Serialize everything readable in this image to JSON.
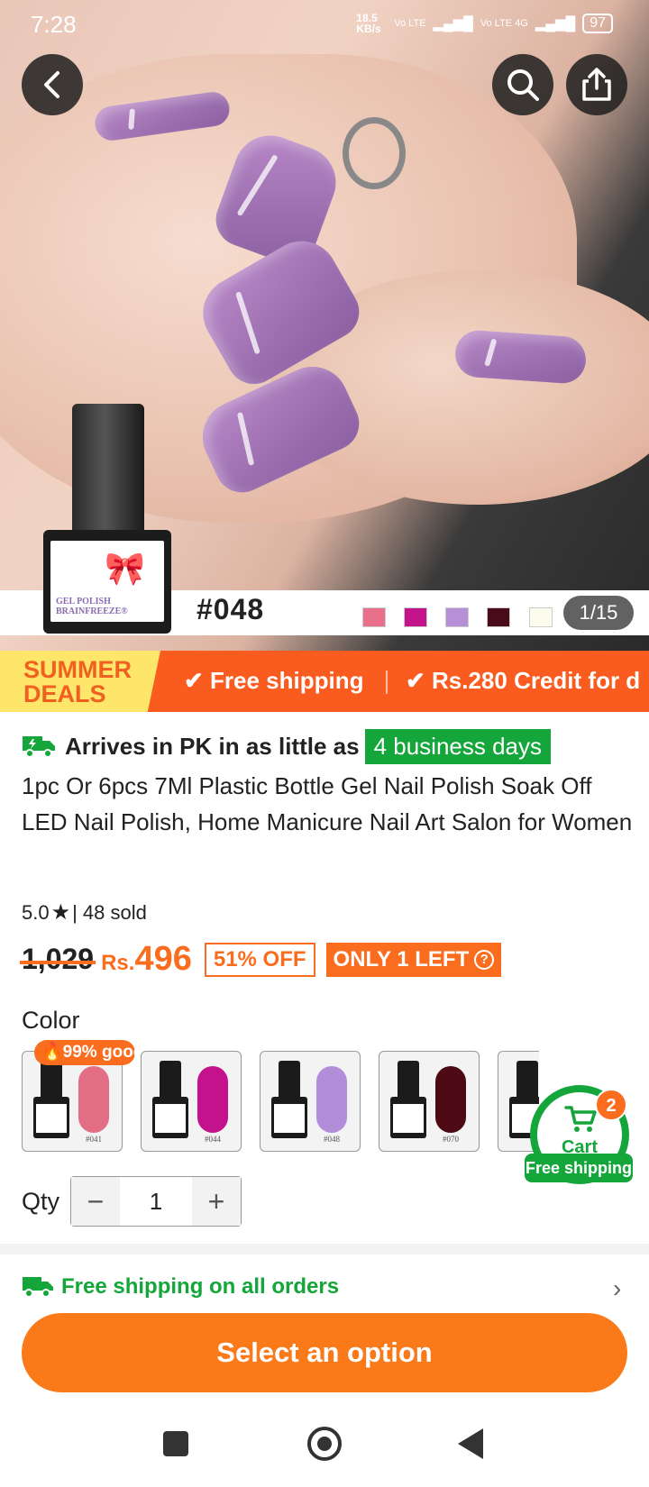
{
  "status_bar": {
    "time": "7:28",
    "net_speed": "18.5 KB/s",
    "sim1": "Vo LTE",
    "sim2": "Vo LTE 4G",
    "battery": "97"
  },
  "hero": {
    "shade_code": "#048",
    "bottle_label": "GEL POLISH BRAINFREEZE®",
    "image_counter": "1/15",
    "swatches": [
      "#e8708a",
      "#c4138a",
      "#b68fd6",
      "#4a0c18",
      "#fbfbee"
    ]
  },
  "promo": {
    "badge_line1": "SUMMER",
    "badge_line2": "DEALS",
    "item1": "✔ Free shipping",
    "item2": "✔ Rs.280 Credit for d"
  },
  "delivery": {
    "text": "Arrives in PK in as little as",
    "badge": "4 business days"
  },
  "product": {
    "title": "1pc Or 6pcs 7Ml Plastic Bottle Gel Nail Polish Soak Off LED Nail Polish, Home Manicure Nail Art Salon for Women",
    "rating": "5.0",
    "sold": "| 48 sold",
    "old_price": "1,029",
    "currency": "Rs.",
    "price": "496",
    "discount": "51% OFF",
    "stock": "ONLY 1 LEFT"
  },
  "color": {
    "label": "Color",
    "good_badge": "99% good",
    "options": [
      {
        "code": "#041",
        "hex": "#e36f86"
      },
      {
        "code": "#044",
        "hex": "#c3128c"
      },
      {
        "code": "#048",
        "hex": "#b28dd8"
      },
      {
        "code": "#070",
        "hex": "#4d0a14"
      },
      {
        "code": "",
        "hex": "#e8ecd8"
      }
    ]
  },
  "cart": {
    "label": "Cart",
    "count": "2",
    "free": "Free shipping"
  },
  "qty": {
    "label": "Qty",
    "value": "1",
    "minus": "−",
    "plus": "+"
  },
  "shipping": {
    "text": "Free shipping on all orders"
  },
  "cta": {
    "label": "Select an option"
  },
  "colors": {
    "accent": "#fa6d1e",
    "green": "#15a63b"
  }
}
